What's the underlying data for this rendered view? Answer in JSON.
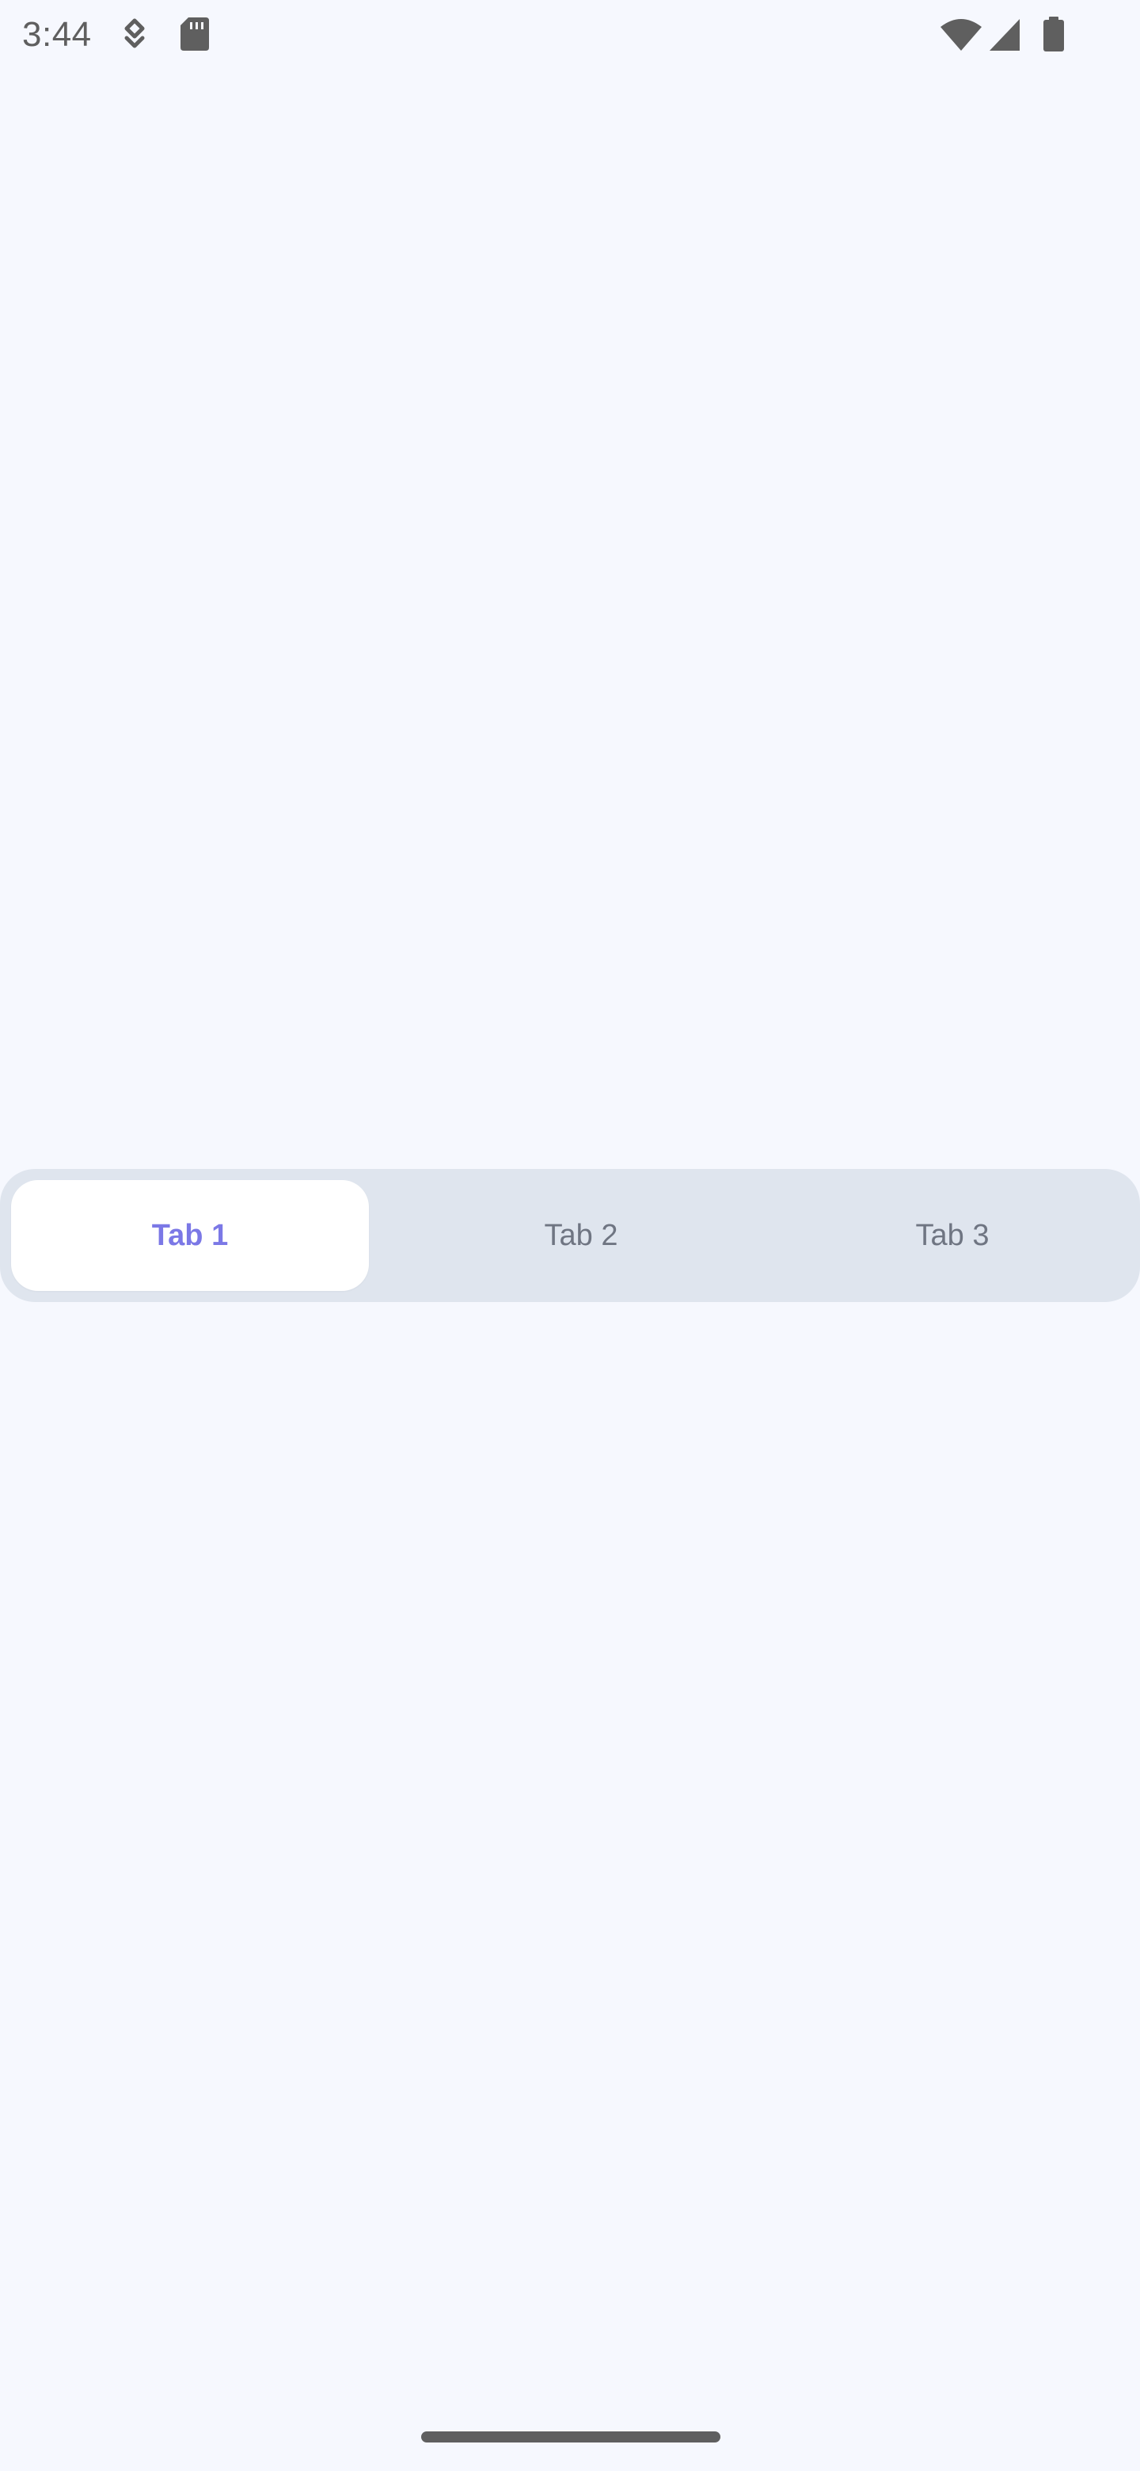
{
  "colors": {
    "background": "#F6F8FE",
    "status_text": "#5F5F5F",
    "status_icon": "#5F5F5F",
    "tab_bar_bg": "#DFE5EE",
    "tab_selected_bg": "#FFFFFF",
    "tab_selected_text": "#7B78E6",
    "tab_unselected_text": "#6F7582",
    "home_indicator": "#5F5F5F"
  },
  "status_bar": {
    "time": "3:44",
    "icons": [
      "navigation-status-icon",
      "sd-card-icon",
      "wifi-icon",
      "cellular-signal-icon",
      "battery-icon"
    ]
  },
  "tabs": [
    {
      "label": "Tab 1",
      "selected": true
    },
    {
      "label": "Tab 2",
      "selected": false
    },
    {
      "label": "Tab 3",
      "selected": false
    }
  ]
}
